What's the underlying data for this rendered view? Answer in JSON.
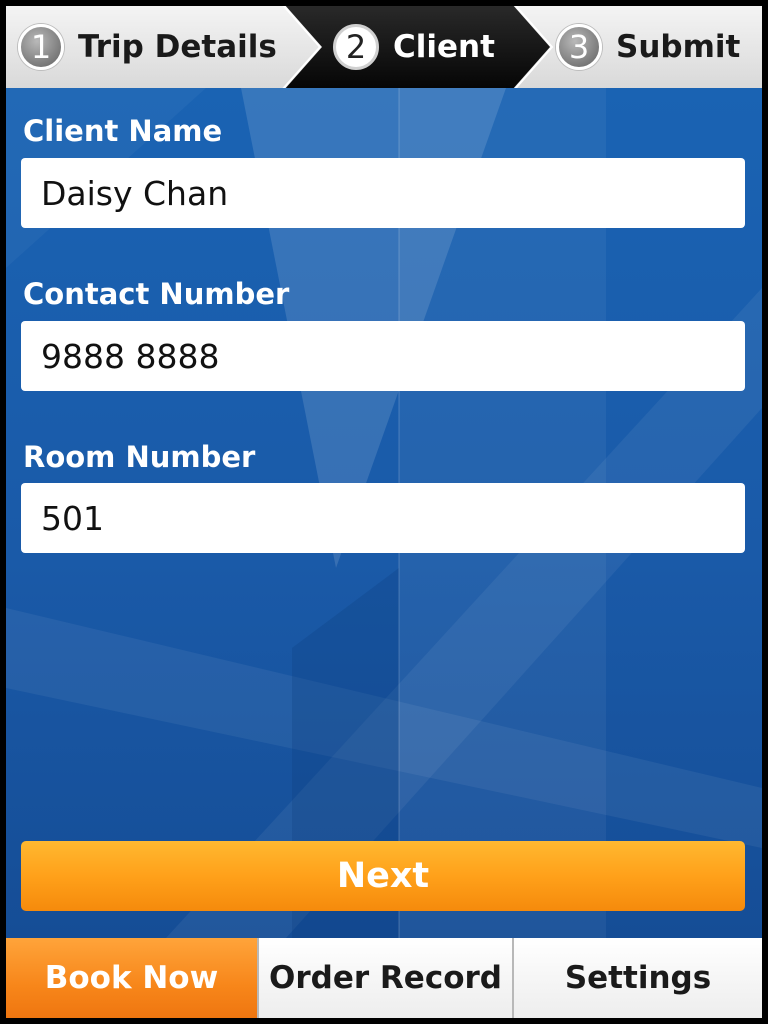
{
  "stepper": {
    "steps": [
      {
        "number": "1",
        "label": "Trip Details",
        "state": "inactive"
      },
      {
        "number": "2",
        "label": "Client",
        "state": "active"
      },
      {
        "number": "3",
        "label": "Submit",
        "state": "inactive"
      }
    ]
  },
  "form": {
    "client_name": {
      "label": "Client Name",
      "value": "Daisy Chan"
    },
    "contact_number": {
      "label": "Contact Number",
      "value": "9888 8888"
    },
    "room_number": {
      "label": "Room Number",
      "value": "501"
    },
    "next_label": "Next"
  },
  "tabbar": {
    "tabs": [
      {
        "label": "Book Now",
        "state": "active"
      },
      {
        "label": "Order Record",
        "state": "normal"
      },
      {
        "label": "Settings",
        "state": "normal"
      }
    ]
  },
  "colors": {
    "accent_orange": "#f7861a",
    "panel_blue": "#1a5aa8",
    "active_step": "#111111"
  }
}
